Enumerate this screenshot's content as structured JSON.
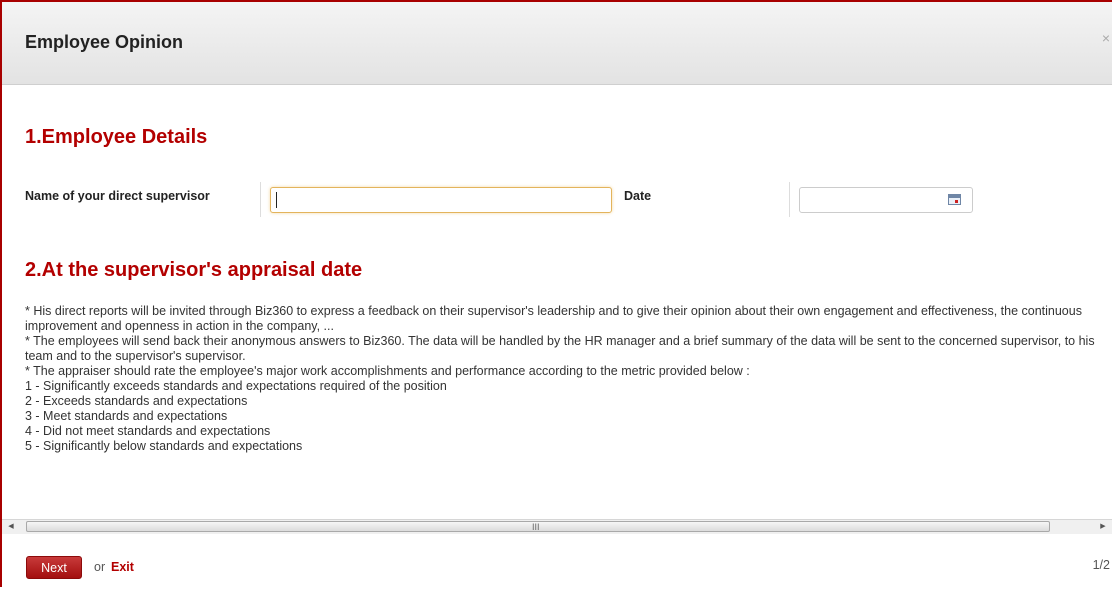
{
  "dialog": {
    "title": "Employee Opinion",
    "close_glyph": "×"
  },
  "section1": {
    "title": "1.Employee Details",
    "supervisor_label": "Name of your direct supervisor",
    "supervisor_value": "",
    "date_label": "Date",
    "date_value": "",
    "calendar_icon": "calendar-icon"
  },
  "section2": {
    "title": "2.At the supervisor's appraisal date",
    "lines": [
      "* His direct reports will be invited through Biz360 to express a feedback on their supervisor's leadership and to give their opinion about their own engagement and effectiveness, the continuous improvement and openness in action in the company, ...",
      "* The employees will send back their anonymous answers to Biz360. The data will be handled by the HR manager and a brief summary of the data will be sent to the concerned supervisor, to his team and to the supervisor's supervisor.",
      "* The appraiser should rate the employee's major work accomplishments and performance according to the metric provided below :",
      "1 - Significantly exceeds standards and expectations required of the position",
      "2 - Exceeds standards and expectations",
      "3 - Meet standards and expectations",
      "4 - Did not meet standards and expectations",
      "5 - Significantly below standards and expectations"
    ]
  },
  "scrollbar": {
    "left_arrow": "◀",
    "right_arrow": "▶",
    "grip": "III"
  },
  "footer": {
    "next_label": "Next",
    "or_text": "or",
    "exit_label": "Exit",
    "page_indicator": "1/2"
  },
  "colors": {
    "accent": "#b30000",
    "button": "#b71c1c",
    "input_focus_border": "#e3b45c"
  }
}
